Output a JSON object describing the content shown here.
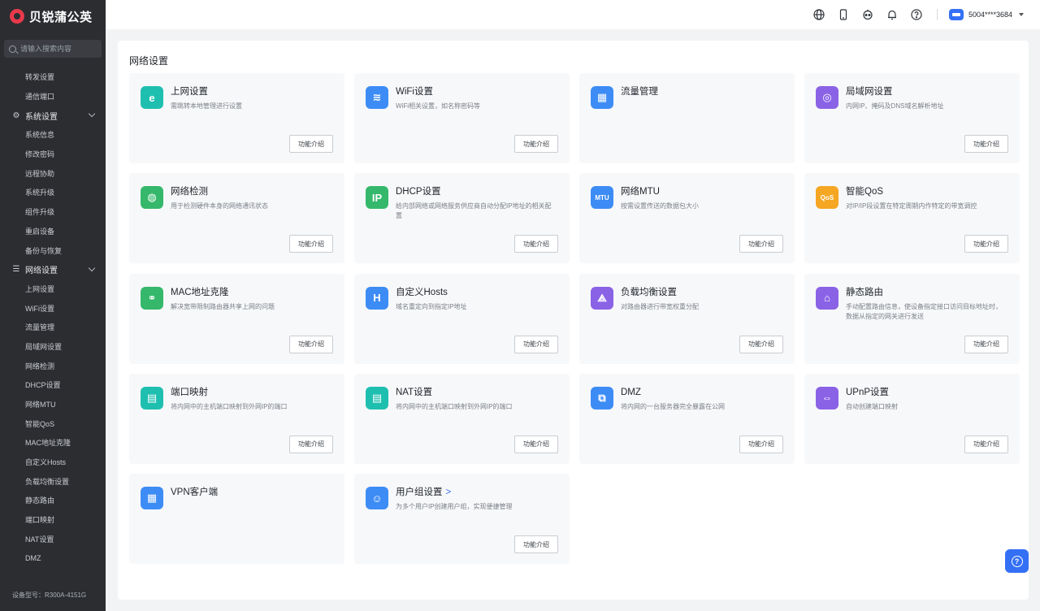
{
  "sidebar": {
    "logo_text": "贝锐蒲公英",
    "search_placeholder": "请输入搜索内容",
    "top_items": [
      "转发设置",
      "通信端口"
    ],
    "groups": [
      {
        "label": "系统设置",
        "icon": "gear-icon",
        "items": [
          "系统信息",
          "修改密码",
          "远程协助",
          "系统升级",
          "组件升级",
          "重启设备",
          "备份与恢复"
        ]
      },
      {
        "label": "网络设置",
        "icon": "list-icon",
        "items": [
          "上网设置",
          "WiFi设置",
          "流量管理",
          "局域网设置",
          "网络检测",
          "DHCP设置",
          "网络MTU",
          "智能QoS",
          "MAC地址克隆",
          "自定义Hosts",
          "负载均衡设置",
          "静态路由",
          "端口映射",
          "NAT设置",
          "DMZ"
        ]
      }
    ],
    "device_model": "设备型号：R300A-4151G"
  },
  "topbar": {
    "icons": [
      "globe-icon",
      "mobile-icon",
      "robot-icon",
      "bell-icon",
      "help-icon"
    ],
    "account": "5004****3684"
  },
  "page": {
    "title": "网络设置",
    "button_label": "功能介绍",
    "cards": [
      {
        "title": "上网设置",
        "desc": "需跳转本地管理进行设置",
        "icon": "internet-icon",
        "glyph": "e",
        "color": "#1fbfb0",
        "has_button": true
      },
      {
        "title": "WiFi设置",
        "desc": "WiFi相关设置，如名称密码等",
        "icon": "wifi-icon",
        "glyph": "≋",
        "color": "#3d8cf5",
        "has_button": true
      },
      {
        "title": "流量管理",
        "desc": "",
        "icon": "traffic-icon",
        "glyph": "▦",
        "color": "#3d8cf5",
        "has_button": false
      },
      {
        "title": "局域网设置",
        "desc": "内网IP、掩码及DNS域名解析地址",
        "icon": "lan-icon",
        "glyph": "◎",
        "color": "#8a62e6",
        "has_button": true
      },
      {
        "title": "网络检测",
        "desc": "用于检测硬件本身的网络通讯状态",
        "icon": "network-check-icon",
        "glyph": "◍",
        "color": "#35b86b",
        "has_button": true
      },
      {
        "title": "DHCP设置",
        "desc": "给内部网络或网络服务供应商自动分配IP地址的相关配置",
        "icon": "ip-icon",
        "glyph": "IP",
        "color": "#35b86b",
        "has_button": true
      },
      {
        "title": "网络MTU",
        "desc": "按需设置传送的数据包大小",
        "icon": "mtu-icon",
        "glyph": "MTU",
        "color": "#3d8cf5",
        "has_button": true
      },
      {
        "title": "智能QoS",
        "desc": "对IP/IP段设置在特定周期内作特定的带宽调控",
        "icon": "qos-icon",
        "glyph": "QoS",
        "color": "#f5a623",
        "has_button": true
      },
      {
        "title": "MAC地址克隆",
        "desc": "解决宽带限制路由器共享上网的问题",
        "icon": "link-icon",
        "glyph": "⚭",
        "color": "#35b86b",
        "has_button": true
      },
      {
        "title": "自定义Hosts",
        "desc": "域名重定向到指定IP地址",
        "icon": "hosts-icon",
        "glyph": "H",
        "color": "#3d8cf5",
        "has_button": true
      },
      {
        "title": "负载均衡设置",
        "desc": "对路由器进行带宽权重分配",
        "icon": "load-balance-icon",
        "glyph": "⟁",
        "color": "#8a62e6",
        "has_button": true
      },
      {
        "title": "静态路由",
        "desc": "手动配置路由信息，使设备指定接口访问目标地址时，数据从指定的网关进行发送",
        "icon": "router-icon",
        "glyph": "⌂",
        "color": "#8a62e6",
        "has_button": true
      },
      {
        "title": "端口映射",
        "desc": "将内网中的主机端口映射到外网IP的端口",
        "icon": "port-icon",
        "glyph": "▤",
        "color": "#1fbfb0",
        "has_button": true
      },
      {
        "title": "NAT设置",
        "desc": "将内网中的主机端口映射到外网IP的端口",
        "icon": "nat-icon",
        "glyph": "▤",
        "color": "#1fbfb0",
        "has_button": true
      },
      {
        "title": "DMZ",
        "desc": "将内网的一台服务器完全暴露在公网",
        "icon": "dmz-icon",
        "glyph": "⧉",
        "color": "#3d8cf5",
        "has_button": true
      },
      {
        "title": "UPnP设置",
        "desc": "自动创建端口映射",
        "icon": "upnp-icon",
        "glyph": "⇔",
        "color": "#8a62e6",
        "has_button": true
      },
      {
        "title": "VPN客户端",
        "desc": "",
        "icon": "vpn-icon",
        "glyph": "▦",
        "color": "#3d8cf5",
        "has_button": false
      },
      {
        "title": "用户组设置",
        "title_suffix": ">",
        "desc": "为多个用户IP创建用户组，实现便捷管理",
        "icon": "user-group-icon",
        "glyph": "☺",
        "color": "#3d8cf5",
        "has_button": true
      }
    ]
  },
  "help_fab": "?"
}
